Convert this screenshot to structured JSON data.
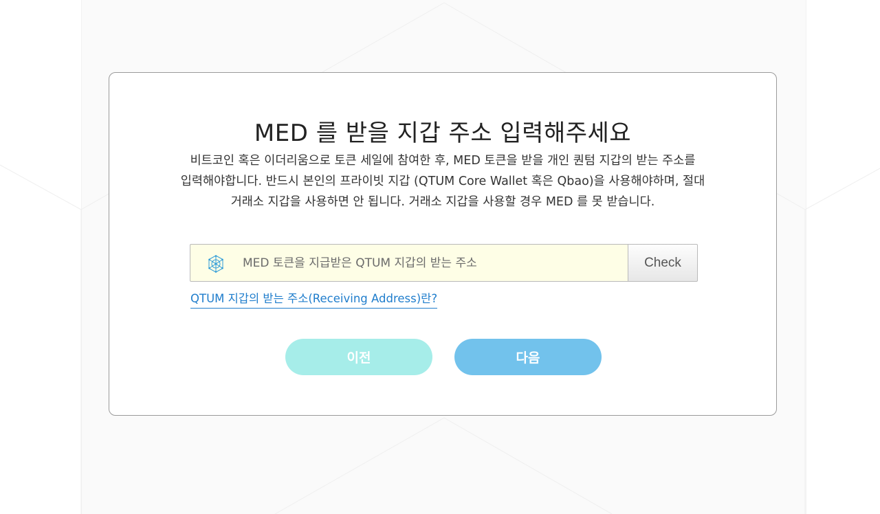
{
  "dialog": {
    "title": "MED 를 받을 지갑 주소 입력해주세요",
    "description": "비트코인 혹은 이더리움으로 토큰 세일에 참여한 후, MED 토큰을 받을 개인 퀀텀 지갑의 받는 주소를 입력해야합니다. 반드시 본인의 프라이빗 지갑 (QTUM Core Wallet 혹은 Qbao)을 사용해야하며, 절대 거래소 지갑을 사용하면 안 됩니다. 거래소 지갑을 사용할 경우 MED 를 못 받습니다."
  },
  "address_input": {
    "placeholder": "MED 토큰을 지급받은 QTUM 지갑의 받는 주소",
    "value": "",
    "icon": "qtum-logo-icon",
    "check_label": "Check"
  },
  "help": {
    "link_text": "QTUM 지갑의 받는 주소(Receiving Address)란?"
  },
  "navigation": {
    "prev_label": "이전",
    "next_label": "다음"
  },
  "colors": {
    "input_background": "#fefee6",
    "link": "#1f7dcc",
    "prev_button": "#a6ede9",
    "next_button": "#72c2ec",
    "qtum_icon": "#2d9bd8"
  }
}
